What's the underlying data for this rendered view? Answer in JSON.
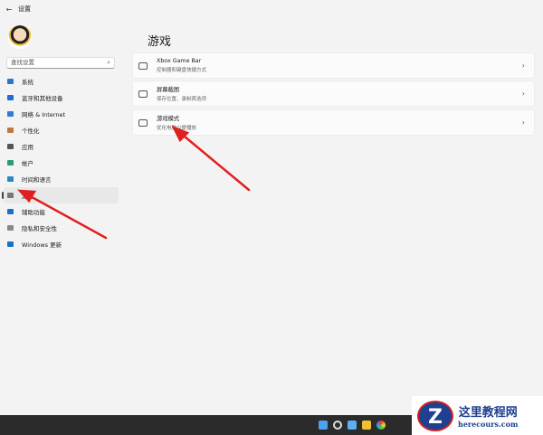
{
  "window": {
    "back_icon": "←",
    "title": "设置"
  },
  "search": {
    "placeholder": "查找设置",
    "icon": "⌕"
  },
  "sidebar": {
    "items": [
      {
        "label": "系统",
        "color": "#2a78c8"
      },
      {
        "label": "蓝牙和其他设备",
        "color": "#1a6fd0"
      },
      {
        "label": "网络 & Internet",
        "color": "#2a7fd0"
      },
      {
        "label": "个性化",
        "color": "#c07a40"
      },
      {
        "label": "应用",
        "color": "#555555"
      },
      {
        "label": "帐户",
        "color": "#2a9a7a"
      },
      {
        "label": "时间和语言",
        "color": "#2a88c8"
      },
      {
        "label": "游戏",
        "color": "#777777"
      },
      {
        "label": "辅助功能",
        "color": "#1a70c8"
      },
      {
        "label": "隐私和安全性",
        "color": "#888888"
      },
      {
        "label": "Windows 更新",
        "color": "#1a70c8"
      }
    ],
    "selected": 7
  },
  "main": {
    "title": "游戏",
    "cards": [
      {
        "title": "Xbox Game Bar",
        "subtitle": "控制器和键盘快捷方式"
      },
      {
        "title": "屏幕截图",
        "subtitle": "保存位置、录制首选项"
      },
      {
        "title": "游戏模式",
        "subtitle": "优化电脑以便播放"
      }
    ],
    "chevron": "›"
  },
  "watermark": {
    "logo": "Z",
    "name": "这里教程网",
    "url": "herecours.com"
  },
  "accent": "#e02020"
}
